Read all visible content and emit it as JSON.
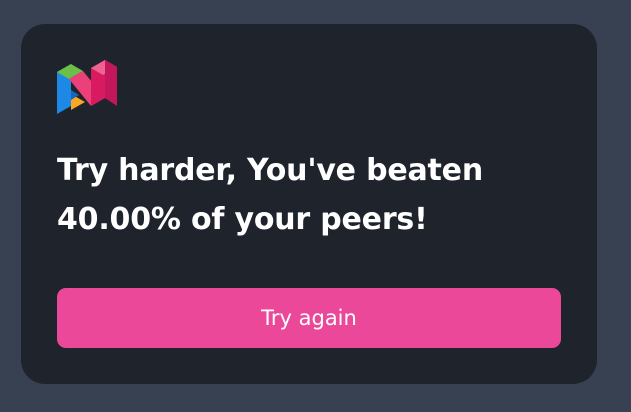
{
  "result": {
    "message": "Try harder, You've beaten 40.00% of your peers!"
  },
  "actions": {
    "try_again_label": "Try again"
  },
  "branding": {
    "logo_icon": "multicolor-n-logo-icon",
    "colors": {
      "logo_green": "#6cc04a",
      "logo_pink": "#ec407a",
      "logo_blue": "#1e88e5",
      "logo_yellow": "#f9a825",
      "button": "#ec4899",
      "card": "#1f232c",
      "background": "#374151"
    }
  }
}
